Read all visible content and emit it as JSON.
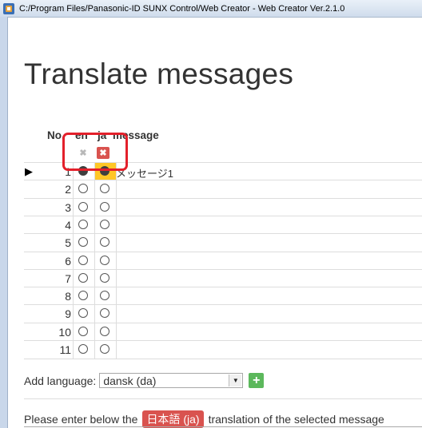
{
  "window": {
    "title": "C:/Program Files/Panasonic-ID SUNX Control/Web Creator - Web Creator Ver.2.1.0",
    "icon": "app-icon"
  },
  "page": {
    "title": "Translate messages"
  },
  "table": {
    "headers": {
      "no": "No.",
      "en": "en",
      "ja": "ja",
      "message": "message"
    },
    "delete_en_icon": "✖",
    "delete_ja_icon": "✖",
    "rows": [
      {
        "no": "1",
        "en": "selected",
        "ja": "selected",
        "message": "メッセージ1",
        "current": true
      },
      {
        "no": "2",
        "en": "empty",
        "ja": "empty",
        "message": ""
      },
      {
        "no": "3",
        "en": "empty",
        "ja": "empty",
        "message": ""
      },
      {
        "no": "4",
        "en": "empty",
        "ja": "empty",
        "message": ""
      },
      {
        "no": "5",
        "en": "empty",
        "ja": "empty",
        "message": ""
      },
      {
        "no": "6",
        "en": "empty",
        "ja": "empty",
        "message": ""
      },
      {
        "no": "7",
        "en": "empty",
        "ja": "empty",
        "message": ""
      },
      {
        "no": "8",
        "en": "empty",
        "ja": "empty",
        "message": ""
      },
      {
        "no": "9",
        "en": "empty",
        "ja": "empty",
        "message": ""
      },
      {
        "no": "10",
        "en": "empty",
        "ja": "empty",
        "message": ""
      },
      {
        "no": "11",
        "en": "empty",
        "ja": "empty",
        "message": ""
      }
    ]
  },
  "add_language": {
    "label": "Add language:",
    "selected": "dansk (da)",
    "button_icon": "+"
  },
  "instruction": {
    "before": "Please enter below the",
    "badge": "日本語 (ja)",
    "after": "translation of the selected message"
  },
  "colors": {
    "accent_red": "#d9534f",
    "selected_cell": "#ffc727",
    "add_green": "#5cb85c",
    "highlight_box": "#e3202b"
  }
}
